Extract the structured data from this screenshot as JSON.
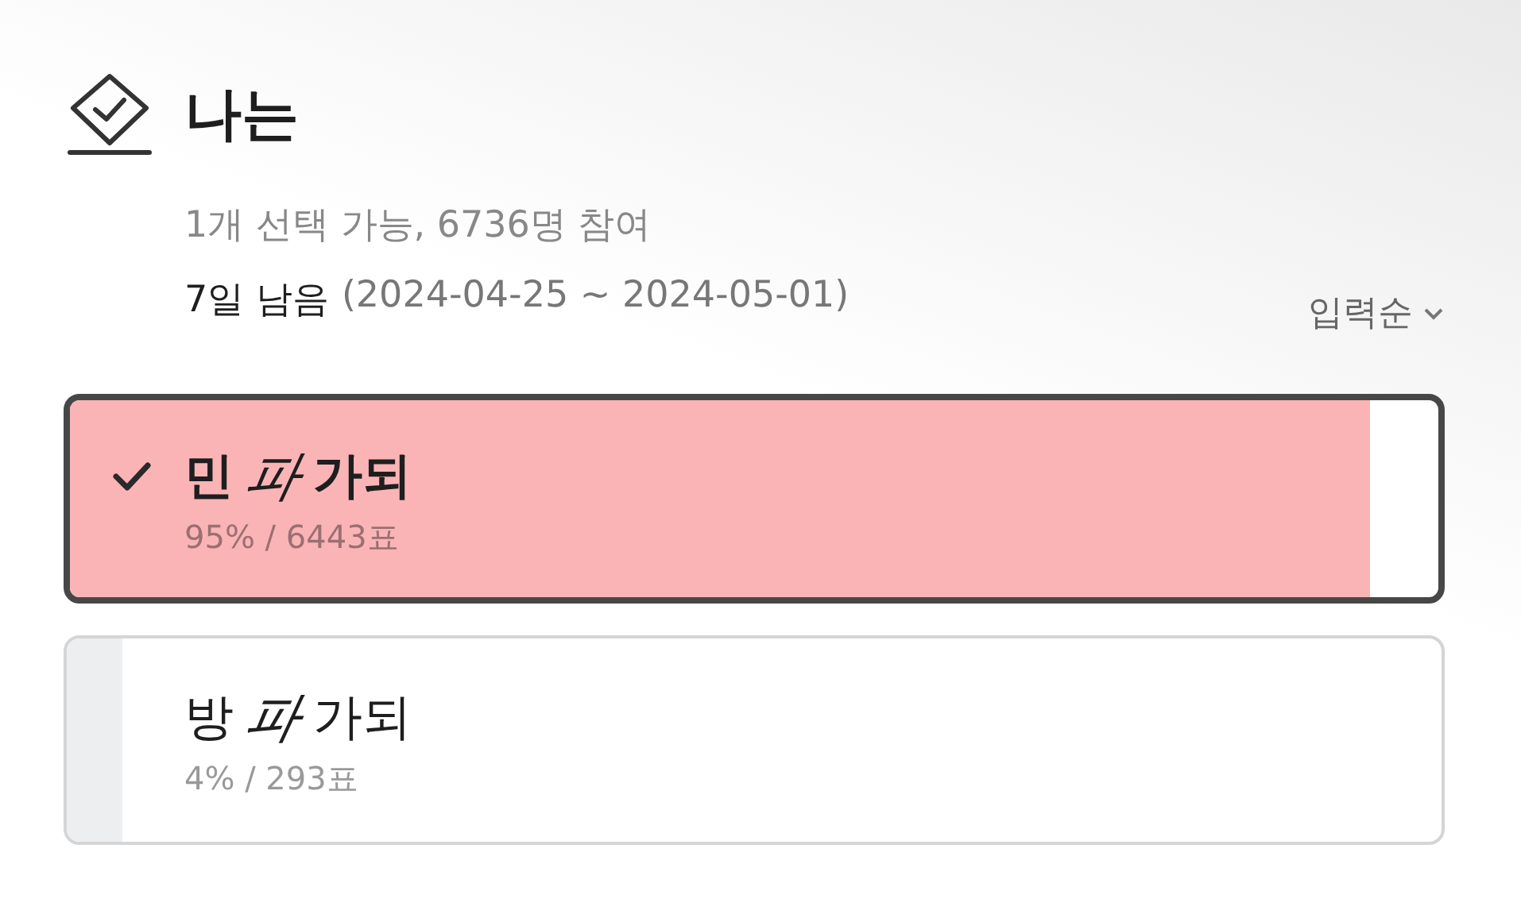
{
  "poll": {
    "title": "나는",
    "meta": "1개 선택 가능, 6736명 참여",
    "remaining": "7일 남음",
    "period": "(2024-04-25 ~ 2024-05-01)",
    "sort": "입력순",
    "options": [
      {
        "prefix": "민",
        "emphasis": "파",
        "suffix": "가되",
        "result": "95% / 6443표",
        "selected": true,
        "level": 0.95
      },
      {
        "prefix": "방",
        "emphasis": "파",
        "suffix": "가되",
        "result": "4% / 293표",
        "selected": false,
        "level": 0.04
      }
    ]
  }
}
